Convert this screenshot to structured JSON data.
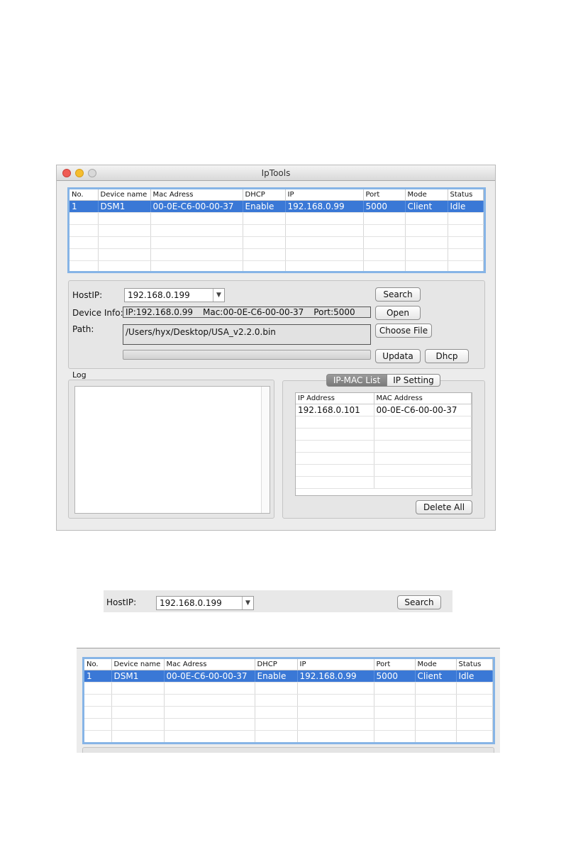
{
  "window": {
    "title": "IpTools"
  },
  "device_table": {
    "columns": [
      "No.",
      "Device name",
      "Mac Adress",
      "DHCP",
      "IP",
      "Port",
      "Mode",
      "Status"
    ],
    "rows": [
      [
        "1",
        "DSM1",
        "00-0E-C6-00-00-37",
        "Enable",
        "192.168.0.99",
        "5000",
        "Client",
        "Idle"
      ]
    ]
  },
  "controls": {
    "host_ip_label": "HostIP:",
    "host_ip_value": "192.168.0.199",
    "device_info_label": "Device Info:",
    "device_info_ip": "IP:192.168.0.99",
    "device_info_mac": "Mac:00-0E-C6-00-00-37",
    "device_info_port": "Port:5000",
    "path_label": "Path:",
    "path_value": "/Users/hyx/Desktop/USA_v2.2.0.bin",
    "search_label": "Search",
    "open_label": "Open",
    "choose_file_label": "Choose File",
    "update_label": "Updata",
    "dhcp_label": "Dhcp",
    "progress": 0
  },
  "log": {
    "label": "Log"
  },
  "tabs": {
    "ip_mac_list": "IP-MAC List",
    "ip_setting": "IP Setting"
  },
  "ip_mac_table": {
    "columns": [
      "IP Address",
      "MAC Address"
    ],
    "rows": [
      [
        "192.168.0.101",
        "00-0E-C6-00-00-37"
      ]
    ]
  },
  "delete_all_label": "Delete All"
}
